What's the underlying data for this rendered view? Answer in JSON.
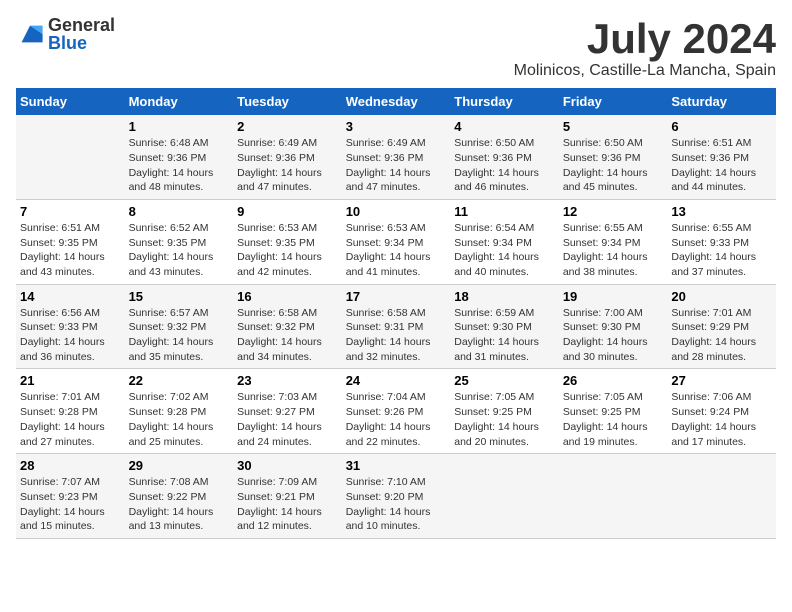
{
  "logo": {
    "text_general": "General",
    "text_blue": "Blue"
  },
  "title": "July 2024",
  "location": "Molinicos, Castille-La Mancha, Spain",
  "days_of_week": [
    "Sunday",
    "Monday",
    "Tuesday",
    "Wednesday",
    "Thursday",
    "Friday",
    "Saturday"
  ],
  "weeks": [
    [
      {
        "day": "",
        "info": ""
      },
      {
        "day": "1",
        "info": "Sunrise: 6:48 AM\nSunset: 9:36 PM\nDaylight: 14 hours\nand 48 minutes."
      },
      {
        "day": "2",
        "info": "Sunrise: 6:49 AM\nSunset: 9:36 PM\nDaylight: 14 hours\nand 47 minutes."
      },
      {
        "day": "3",
        "info": "Sunrise: 6:49 AM\nSunset: 9:36 PM\nDaylight: 14 hours\nand 47 minutes."
      },
      {
        "day": "4",
        "info": "Sunrise: 6:50 AM\nSunset: 9:36 PM\nDaylight: 14 hours\nand 46 minutes."
      },
      {
        "day": "5",
        "info": "Sunrise: 6:50 AM\nSunset: 9:36 PM\nDaylight: 14 hours\nand 45 minutes."
      },
      {
        "day": "6",
        "info": "Sunrise: 6:51 AM\nSunset: 9:36 PM\nDaylight: 14 hours\nand 44 minutes."
      }
    ],
    [
      {
        "day": "7",
        "info": "Sunrise: 6:51 AM\nSunset: 9:35 PM\nDaylight: 14 hours\nand 43 minutes."
      },
      {
        "day": "8",
        "info": "Sunrise: 6:52 AM\nSunset: 9:35 PM\nDaylight: 14 hours\nand 43 minutes."
      },
      {
        "day": "9",
        "info": "Sunrise: 6:53 AM\nSunset: 9:35 PM\nDaylight: 14 hours\nand 42 minutes."
      },
      {
        "day": "10",
        "info": "Sunrise: 6:53 AM\nSunset: 9:34 PM\nDaylight: 14 hours\nand 41 minutes."
      },
      {
        "day": "11",
        "info": "Sunrise: 6:54 AM\nSunset: 9:34 PM\nDaylight: 14 hours\nand 40 minutes."
      },
      {
        "day": "12",
        "info": "Sunrise: 6:55 AM\nSunset: 9:34 PM\nDaylight: 14 hours\nand 38 minutes."
      },
      {
        "day": "13",
        "info": "Sunrise: 6:55 AM\nSunset: 9:33 PM\nDaylight: 14 hours\nand 37 minutes."
      }
    ],
    [
      {
        "day": "14",
        "info": "Sunrise: 6:56 AM\nSunset: 9:33 PM\nDaylight: 14 hours\nand 36 minutes."
      },
      {
        "day": "15",
        "info": "Sunrise: 6:57 AM\nSunset: 9:32 PM\nDaylight: 14 hours\nand 35 minutes."
      },
      {
        "day": "16",
        "info": "Sunrise: 6:58 AM\nSunset: 9:32 PM\nDaylight: 14 hours\nand 34 minutes."
      },
      {
        "day": "17",
        "info": "Sunrise: 6:58 AM\nSunset: 9:31 PM\nDaylight: 14 hours\nand 32 minutes."
      },
      {
        "day": "18",
        "info": "Sunrise: 6:59 AM\nSunset: 9:30 PM\nDaylight: 14 hours\nand 31 minutes."
      },
      {
        "day": "19",
        "info": "Sunrise: 7:00 AM\nSunset: 9:30 PM\nDaylight: 14 hours\nand 30 minutes."
      },
      {
        "day": "20",
        "info": "Sunrise: 7:01 AM\nSunset: 9:29 PM\nDaylight: 14 hours\nand 28 minutes."
      }
    ],
    [
      {
        "day": "21",
        "info": "Sunrise: 7:01 AM\nSunset: 9:28 PM\nDaylight: 14 hours\nand 27 minutes."
      },
      {
        "day": "22",
        "info": "Sunrise: 7:02 AM\nSunset: 9:28 PM\nDaylight: 14 hours\nand 25 minutes."
      },
      {
        "day": "23",
        "info": "Sunrise: 7:03 AM\nSunset: 9:27 PM\nDaylight: 14 hours\nand 24 minutes."
      },
      {
        "day": "24",
        "info": "Sunrise: 7:04 AM\nSunset: 9:26 PM\nDaylight: 14 hours\nand 22 minutes."
      },
      {
        "day": "25",
        "info": "Sunrise: 7:05 AM\nSunset: 9:25 PM\nDaylight: 14 hours\nand 20 minutes."
      },
      {
        "day": "26",
        "info": "Sunrise: 7:05 AM\nSunset: 9:25 PM\nDaylight: 14 hours\nand 19 minutes."
      },
      {
        "day": "27",
        "info": "Sunrise: 7:06 AM\nSunset: 9:24 PM\nDaylight: 14 hours\nand 17 minutes."
      }
    ],
    [
      {
        "day": "28",
        "info": "Sunrise: 7:07 AM\nSunset: 9:23 PM\nDaylight: 14 hours\nand 15 minutes."
      },
      {
        "day": "29",
        "info": "Sunrise: 7:08 AM\nSunset: 9:22 PM\nDaylight: 14 hours\nand 13 minutes."
      },
      {
        "day": "30",
        "info": "Sunrise: 7:09 AM\nSunset: 9:21 PM\nDaylight: 14 hours\nand 12 minutes."
      },
      {
        "day": "31",
        "info": "Sunrise: 7:10 AM\nSunset: 9:20 PM\nDaylight: 14 hours\nand 10 minutes."
      },
      {
        "day": "",
        "info": ""
      },
      {
        "day": "",
        "info": ""
      },
      {
        "day": "",
        "info": ""
      }
    ]
  ]
}
